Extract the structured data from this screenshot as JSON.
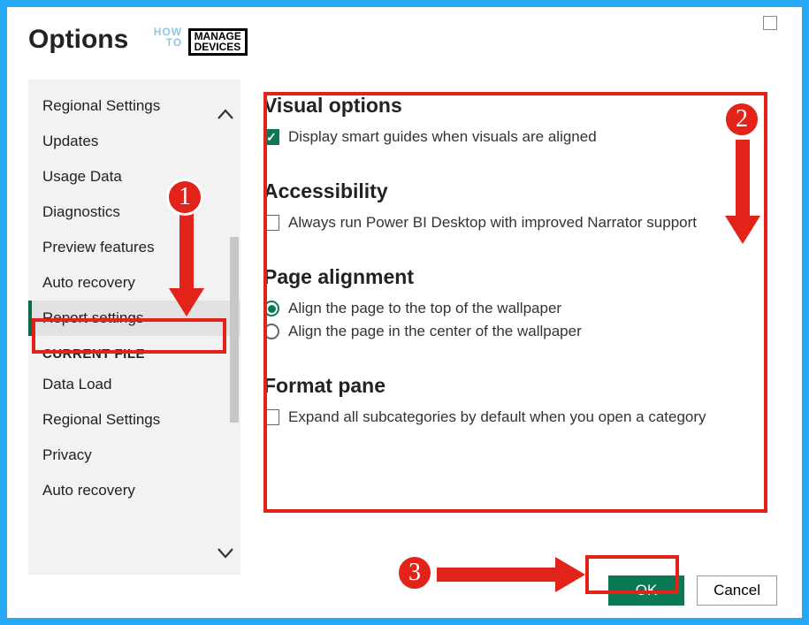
{
  "header": {
    "title": "Options",
    "logo": {
      "how": "HOW",
      "to": "TO",
      "manage": "MANAGE",
      "devices": "DEVICES"
    }
  },
  "sidebar": {
    "items": [
      {
        "label": "Regional Settings"
      },
      {
        "label": "Updates"
      },
      {
        "label": "Usage Data"
      },
      {
        "label": "Diagnostics"
      },
      {
        "label": "Preview features"
      },
      {
        "label": "Auto recovery"
      },
      {
        "label": "Report settings",
        "selected": true
      }
    ],
    "currentFileHeader": "CURRENT FILE",
    "currentFileItems": [
      {
        "label": "Data Load"
      },
      {
        "label": "Regional Settings"
      },
      {
        "label": "Privacy"
      },
      {
        "label": "Auto recovery"
      }
    ]
  },
  "main": {
    "visualOptions": {
      "title": "Visual options",
      "check1": "Display smart guides when visuals are aligned"
    },
    "accessibility": {
      "title": "Accessibility",
      "check1": "Always run Power BI Desktop with improved Narrator support"
    },
    "pageAlignment": {
      "title": "Page alignment",
      "radio1": "Align the page to the top of the wallpaper",
      "radio2": "Align the page in the center of the wallpaper"
    },
    "formatPane": {
      "title": "Format pane",
      "check1": "Expand all subcategories by default when you open a category"
    }
  },
  "footer": {
    "ok": "OK",
    "cancel": "Cancel"
  },
  "annotations": {
    "c1": "1",
    "c2": "2",
    "c3": "3"
  }
}
